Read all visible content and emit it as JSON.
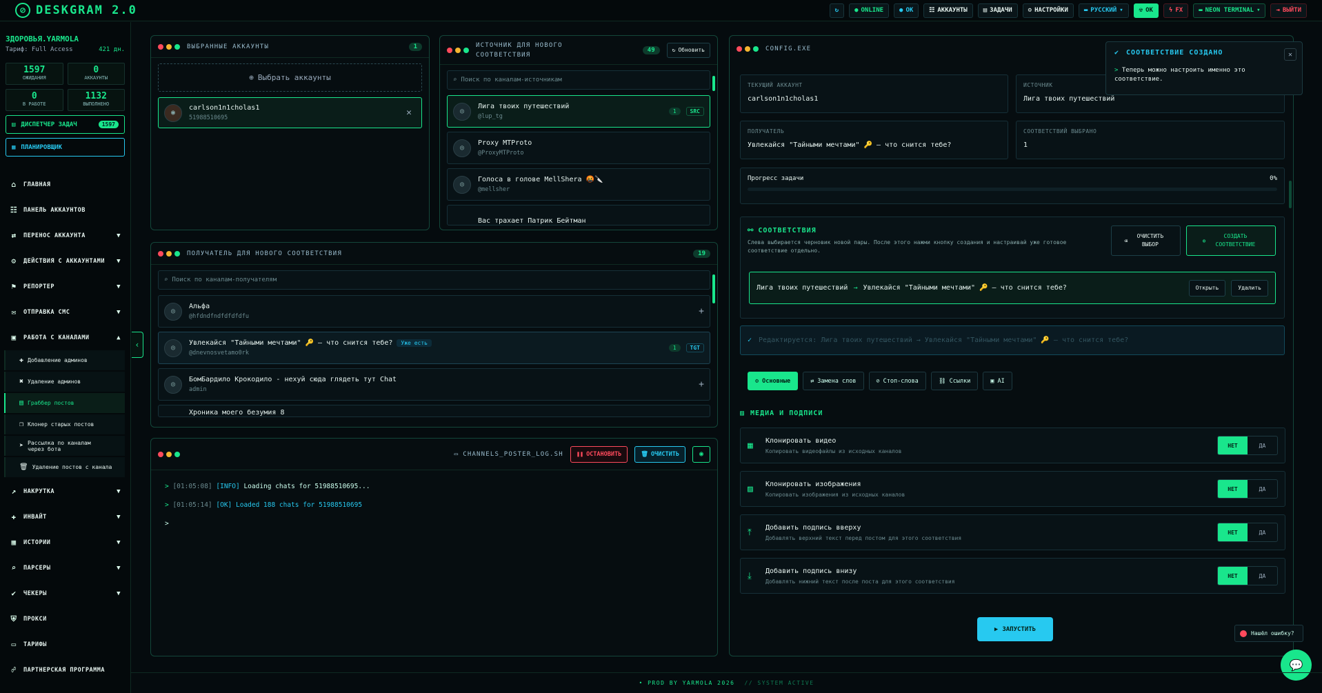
{
  "app": {
    "title": "DESKGRAM 2.0"
  },
  "topnav": {
    "refresh_icon": "refresh-icon",
    "online": "ONLINE",
    "ok": "OK",
    "accounts": "АККАУНТЫ",
    "tasks": "ЗАДАЧИ",
    "settings": "НАСТРОЙКИ",
    "language": "РУССКИЙ",
    "status_ok": "OK",
    "fx": "FX",
    "theme": "NEON TERMINAL",
    "logout": "ВЫЙТИ"
  },
  "user": {
    "name": "ЗДОРОВЬЯ.YARMOLA",
    "tariff": "Тариф: Full Access",
    "days": "421 дн."
  },
  "stats": [
    {
      "value": "1597",
      "label": "ожидания"
    },
    {
      "value": "0",
      "label": "аккаунты"
    },
    {
      "value": "0",
      "label": "в работе"
    },
    {
      "value": "1132",
      "label": "выполнено"
    }
  ],
  "task_manager": {
    "label": "ДИСПЕТЧЕР ЗАДАЧ",
    "badge": "1597"
  },
  "planner": {
    "label": "ПЛАНИРОВЩИК"
  },
  "menu": [
    {
      "label": "ГЛАВНАЯ",
      "icon": "home-icon",
      "glyph": "⌂",
      "chev": ""
    },
    {
      "label": "ПАНЕЛЬ АККАУНТОВ",
      "icon": "users-icon",
      "glyph": "☷",
      "chev": ""
    },
    {
      "label": "ПЕРЕНОС АККАУНТА",
      "icon": "transfer-icon",
      "glyph": "⇄",
      "chev": "▼"
    },
    {
      "label": "ДЕЙСТВИЯ С АККАУНТАМИ",
      "icon": "user-gear-icon",
      "glyph": "⚙",
      "chev": "▼"
    },
    {
      "label": "РЕПОРТЕР",
      "icon": "flag-icon",
      "glyph": "⚑",
      "chev": "▼"
    },
    {
      "label": "ОТПРАВКА СМС",
      "icon": "chat-icon",
      "glyph": "✉",
      "chev": "▼"
    },
    {
      "label": "РАБОТА С КАНАЛАМИ",
      "icon": "briefcase-icon",
      "glyph": "▣",
      "chev": "▲"
    }
  ],
  "submenu": [
    {
      "label": "Добавление админов",
      "glyph": "✚"
    },
    {
      "label": "Удаление админов",
      "glyph": "✖"
    },
    {
      "label": "Граббер постов",
      "glyph": "▤"
    },
    {
      "label": "Клонер старых постов",
      "glyph": "❐"
    },
    {
      "label": "Рассылка по каналам через бота",
      "glyph": "➤"
    },
    {
      "label": "Удаление постов с канала",
      "glyph": "🗑"
    }
  ],
  "menu2": [
    {
      "label": "НАКРУТКА",
      "icon": "chart-icon",
      "glyph": "↗",
      "chev": "▼"
    },
    {
      "label": "ИНВАЙТ",
      "icon": "invite-icon",
      "glyph": "✚",
      "chev": "▼"
    },
    {
      "label": "ИСТОРИИ",
      "icon": "stories-icon",
      "glyph": "▦",
      "chev": "▼"
    },
    {
      "label": "ПАРСЕРЫ",
      "icon": "search-icon",
      "glyph": "⌕",
      "chev": "▼"
    },
    {
      "label": "ЧЕКЕРЫ",
      "icon": "check-icon",
      "glyph": "✔",
      "chev": "▼"
    },
    {
      "label": "ПРОКСИ",
      "icon": "shield-icon",
      "glyph": "⛨",
      "chev": ""
    },
    {
      "label": "ТАРИФЫ",
      "icon": "card-icon",
      "glyph": "▭",
      "chev": ""
    },
    {
      "label": "ПАРТНЕРСКАЯ ПРОГРАММА",
      "icon": "partner-icon",
      "glyph": "☍",
      "chev": ""
    }
  ],
  "selected_accounts": {
    "title": "ВЫБРАННЫЕ АККАУНТЫ",
    "count": "1",
    "choose": "Выбрать аккаунты",
    "account_name": "carlson1n1cholas1",
    "account_id": "51988510695"
  },
  "source": {
    "title": "ИСТОЧНИК ДЛЯ НОВОГО СООТВЕТСТВИЯ",
    "count": "49",
    "refresh": "Обновить",
    "placeholder": "Поиск по каналам-источникам",
    "items": [
      {
        "name": "Лига твоих путешествий",
        "handle": "@lup_tg",
        "num": "1",
        "tag": "SRC"
      },
      {
        "name": "Proxy MTProto",
        "handle": "@ProxyMTProto"
      },
      {
        "name": "Голоса в голове MellShera 🤬🔪",
        "handle": "@mellsher"
      },
      {
        "name": "Вас трахает Патрик Бейтман",
        "handle": ""
      }
    ]
  },
  "recipient": {
    "title": "ПОЛУЧАТЕЛЬ ДЛЯ НОВОГО СООТВЕТСТВИЯ",
    "count": "19",
    "placeholder": "Поиск по каналам-получателям",
    "items": [
      {
        "name": "Альфа",
        "handle": "@hfdndfndfdfdfdfu"
      },
      {
        "name": "Увлекайся \"Тайными мечтами\" 🔑 — что снится тебе?",
        "handle": "@dnevnosvetamo0rk",
        "already": "Уже есть",
        "num": "1",
        "tag": "TGT"
      },
      {
        "name": "БомБардило Крокодило - нехуй сюда глядеть тут Chat",
        "handle": "admin"
      },
      {
        "name": "Хроника моего безумия 8",
        "handle": ""
      }
    ]
  },
  "log": {
    "file": "CHANNELS_POSTER_LOG.SH",
    "stop": "ОСТАНОВИТЬ",
    "clear": "ОЧИСТИТЬ",
    "lines": [
      {
        "time": "[01:05:08]",
        "level": "[INFO]",
        "text": "Loading chats for 51988510695..."
      },
      {
        "time": "[01:05:14]",
        "level": "[OK]",
        "text": "Loaded 188 chats for 51988510695"
      }
    ],
    "prompt": ">"
  },
  "config": {
    "title": "CONFIG.EXE",
    "current_account_label": "ТЕКУЩИЙ АККАУНТ",
    "current_account": "carlson1n1cholas1",
    "source_label": "ИСТОЧНИК",
    "source": "Лига твоих путешествий",
    "recipient_label": "ПОЛУЧАТЕЛЬ",
    "recipient": "Увлекайся \"Тайными мечтами\" 🔑 — что снится тебе?",
    "matches_label": "СООТВЕТСТВИЙ ВЫБРАНО",
    "matches": "1",
    "progress_label": "Прогресс задачи",
    "progress": "0%",
    "match_title": "СООТВЕТСТВИЯ",
    "match_desc": "Слева выбирается черновик новой пары. После этого нажми кнопку создания и настраивай уже готовое соответствие отдельно.",
    "clear_btn": "ОЧИСТИТЬ ВЫБОР",
    "create_btn": "СОЗДАТЬ СООТВЕТСТВИЕ",
    "pair_src": "Лига твоих путешествий",
    "pair_dst": "Увлекайся \"Тайными мечтами\" 🔑 — что снится тебе?",
    "open": "Открыть",
    "delete": "Удалить",
    "edit_line": "Редактируется: Лига твоих путешествий → Увлекайся \"Тайными мечтами\" 🔑 — что снится тебе?",
    "tabs": [
      "Основные",
      "Замена слов",
      "Стоп-слова",
      "Ссылки",
      "AI"
    ],
    "media_title": "МЕДИА И ПОДПИСИ",
    "media": [
      {
        "title": "Клонировать видео",
        "desc": "Копировать видеофайлы из исходных каналов",
        "icon": "film-icon",
        "glyph": "▦"
      },
      {
        "title": "Клонировать изображения",
        "desc": "Копировать изображения из исходных каналов",
        "icon": "image-icon",
        "glyph": "▨"
      },
      {
        "title": "Добавить подпись вверху",
        "desc": "Добавлять верхний текст перед постом для этого соответствия",
        "icon": "arrow-up-icon",
        "glyph": "⤒"
      },
      {
        "title": "Добавить подпись внизу",
        "desc": "Добавлять нижний текст после поста для этого соответствия",
        "icon": "arrow-down-icon",
        "glyph": "⤓"
      }
    ],
    "no": "НЕТ",
    "yes": "ДА",
    "run": "ЗАПУСТИТЬ"
  },
  "toast": {
    "title": "СООТВЕТСТВИЕ СОЗДАНО",
    "text": "Теперь можно настроить именно это соответствие."
  },
  "bug": {
    "label": "Нашёл ошибку?"
  },
  "footer": {
    "prod": "• PROD BY YARMOLA 2026",
    "sys": "// SYSTEM ACTIVE"
  }
}
